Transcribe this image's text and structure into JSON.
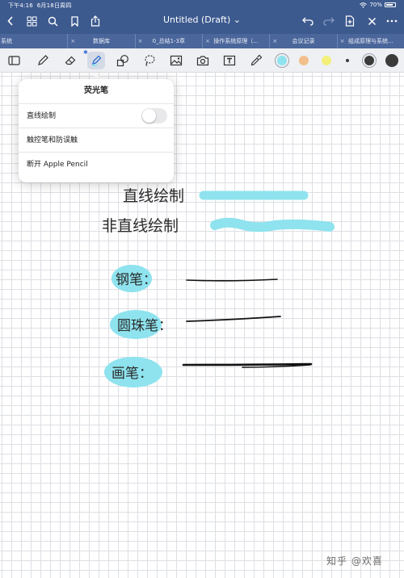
{
  "status": {
    "time": "下午4:16",
    "date": "6月18日周四",
    "battery": "70%"
  },
  "header": {
    "title": "Untitled (Draft) ⌄"
  },
  "tabs": [
    {
      "label": "系统"
    },
    {
      "label": "数据库"
    },
    {
      "label": "0_总结1-3章"
    },
    {
      "label": "操作系统原理（..."
    },
    {
      "label": "会议记录"
    },
    {
      "label": "组成原理与系统..."
    }
  ],
  "toolbar": {
    "colors": {
      "highlighter_cyan": "#8ee3ee",
      "highlighter_orange": "#f2bf8c",
      "highlighter_yellow": "#f3f07a",
      "ink_dark": "#3b3b3b"
    },
    "icons": [
      "sidebar-icon",
      "pen-icon",
      "eraser-icon",
      "highlighter-icon",
      "shapes-icon",
      "lasso-icon",
      "image-icon",
      "camera-icon",
      "text-icon",
      "eyedropper-icon"
    ]
  },
  "popover": {
    "title": "荧光笔",
    "rows": [
      {
        "label": "直线绘制",
        "toggle": false
      },
      {
        "label": "触控笔和防误触"
      },
      {
        "label": "断开 Apple Pencil"
      }
    ]
  },
  "canvas": {
    "lines": [
      {
        "text": "直线绘制"
      },
      {
        "text": "非直线绘制"
      },
      {
        "text": "钢笔："
      },
      {
        "text": "圆珠笔："
      },
      {
        "text": "画笔："
      }
    ]
  },
  "watermark": "知乎 @欢喜"
}
